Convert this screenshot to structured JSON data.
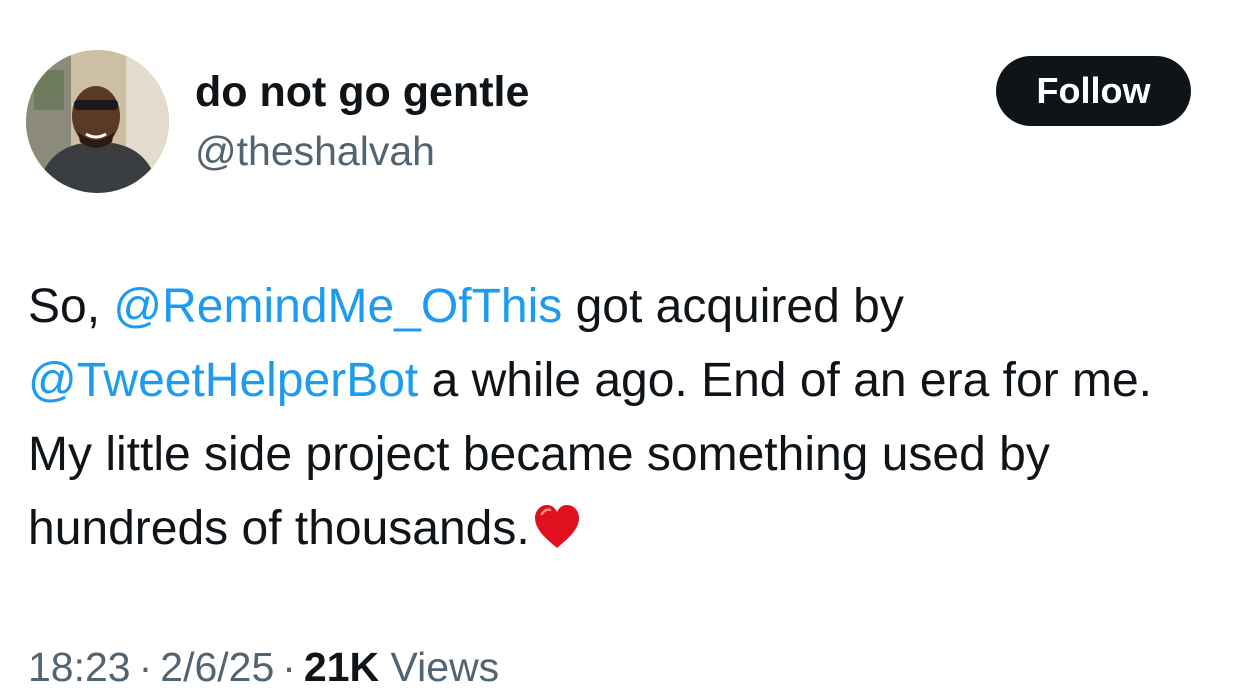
{
  "author": {
    "display_name": "do not go gentle",
    "handle": "@theshalvah",
    "avatar_icon": "profile-photo"
  },
  "follow_button": {
    "label": "Follow"
  },
  "tweet": {
    "prefix": "So,",
    "mention_1": "@RemindMe_OfThis",
    "text_1": "got acquired by",
    "mention_2": "@TweetHelperBot",
    "text_2": "a while ago. End of an era for me. My little side project became something used by hundreds of thousands.",
    "emoji_icon": "red-heart-icon"
  },
  "meta": {
    "time": "18:23",
    "date": "2/6/25",
    "views_count": "21K",
    "views_label": "Views",
    "separator": "·"
  },
  "colors": {
    "mention": "#1d9bf0",
    "secondary_text": "#536471",
    "primary_text": "#0f1419",
    "follow_bg": "#0f1419"
  }
}
